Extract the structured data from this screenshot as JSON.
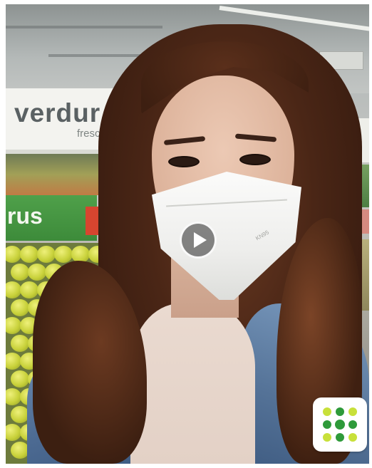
{
  "scene": {
    "banner_word": "verdur",
    "banner_sub": "fresc",
    "green_sign_word": "rus",
    "mask_print": "KN95"
  },
  "video": {
    "play_label": "play"
  },
  "icons": {
    "play": "play-icon",
    "logo": "dot-grid-logo-icon"
  },
  "colors": {
    "logo_light_green": "#c8e03a",
    "logo_dark_green": "#2e9a3a",
    "play_overlay": "#282828"
  }
}
